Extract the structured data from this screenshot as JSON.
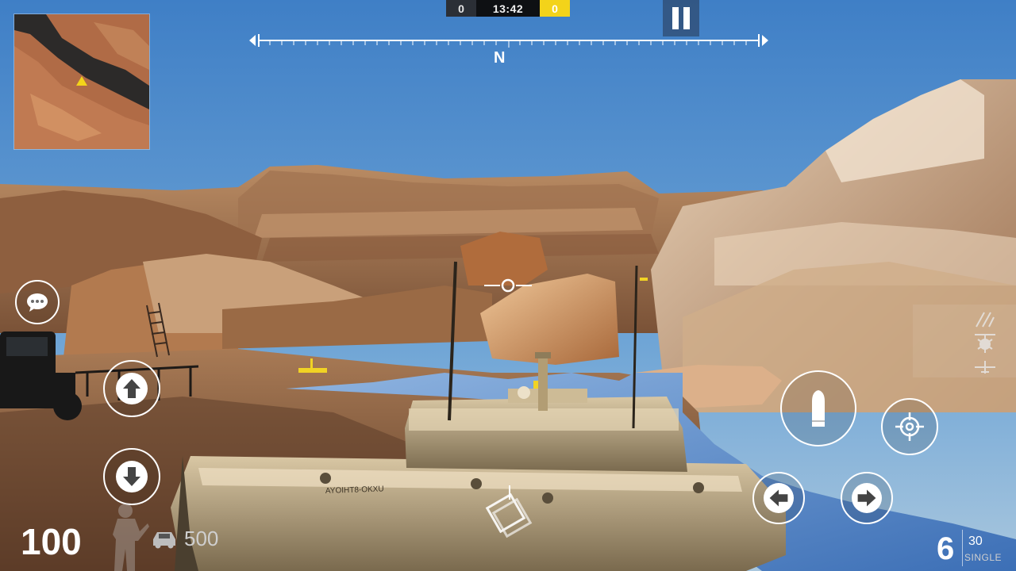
{
  "scoreboard": {
    "team_a_score": "0",
    "timer": "13:42",
    "team_b_score": "0",
    "team_b_color": "#f3d31a"
  },
  "compass": {
    "heading_label": "N"
  },
  "hud": {
    "health": "100",
    "vehicle_health": "500",
    "ammo_loaded": "6",
    "ammo_reserve": "30",
    "fire_mode": "SINGLE"
  },
  "icons": {
    "pause": "pause-icon",
    "chat": "chat-bubble-icon",
    "move_forward": "arrow-up-icon",
    "move_backward": "arrow-down-icon",
    "turn_left": "arrow-left-icon",
    "turn_right": "arrow-right-icon",
    "fire": "bullet-icon",
    "aim": "crosshair-icon",
    "switch_view": "rotate-view-icon",
    "vehicle": "car-icon",
    "soldier": "soldier-silhouette-icon",
    "player_marker": "triangle-marker-icon",
    "vehicle_selector": [
      "missile-icon",
      "helicopter-icon",
      "airplane-icon"
    ]
  }
}
